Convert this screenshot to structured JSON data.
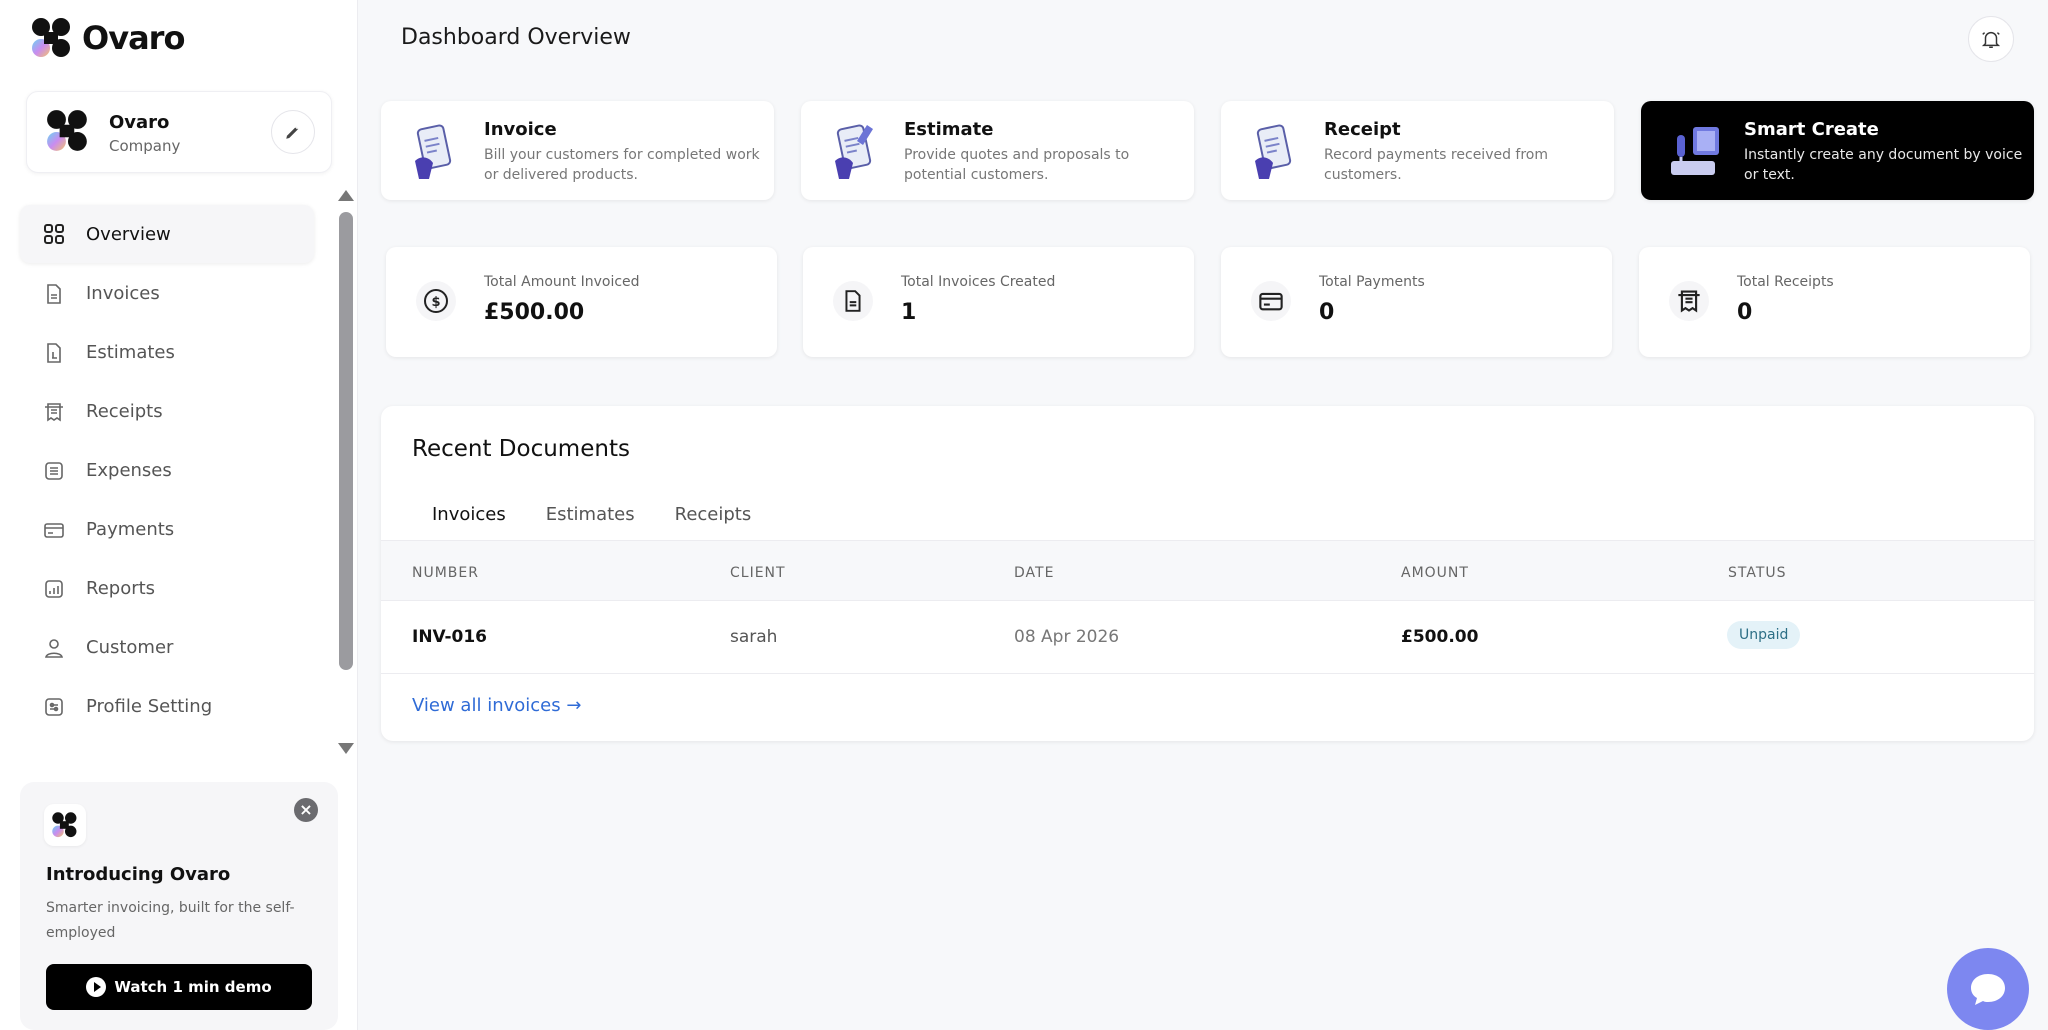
{
  "brand": {
    "name": "Ovaro"
  },
  "company": {
    "name": "Ovaro",
    "type": "Company"
  },
  "sidebar": {
    "items": [
      {
        "label": "Overview",
        "icon": "grid-icon",
        "active": true
      },
      {
        "label": "Invoices",
        "icon": "document-icon"
      },
      {
        "label": "Estimates",
        "icon": "estimate-icon"
      },
      {
        "label": "Receipts",
        "icon": "receipt-icon"
      },
      {
        "label": "Expenses",
        "icon": "list-icon"
      },
      {
        "label": "Payments",
        "icon": "card-icon"
      },
      {
        "label": "Reports",
        "icon": "chart-icon"
      },
      {
        "label": "Customer",
        "icon": "user-icon"
      },
      {
        "label": "Profile Setting",
        "icon": "settings-icon"
      }
    ]
  },
  "promo": {
    "title": "Introducing Ovaro",
    "text": "Smarter invoicing, built for the self-employed",
    "button": "Watch 1 min demo"
  },
  "header": {
    "title": "Dashboard Overview"
  },
  "actions": [
    {
      "title": "Invoice",
      "desc": "Bill your customers for completed work or delivered products."
    },
    {
      "title": "Estimate",
      "desc": "Provide quotes and proposals to potential customers."
    },
    {
      "title": "Receipt",
      "desc": "Record payments received from customers."
    },
    {
      "title": "Smart Create",
      "desc": "Instantly create any document by voice or text."
    }
  ],
  "stats": [
    {
      "label": "Total Amount Invoiced",
      "value": "£500.00",
      "icon": "dollar-icon"
    },
    {
      "label": "Total Invoices Created",
      "value": "1",
      "icon": "document-icon"
    },
    {
      "label": "Total Payments",
      "value": "0",
      "icon": "card-icon"
    },
    {
      "label": "Total Receipts",
      "value": "0",
      "icon": "receipt-icon"
    }
  ],
  "recent": {
    "title": "Recent Documents",
    "tabs": [
      "Invoices",
      "Estimates",
      "Receipts"
    ],
    "columns": [
      "NUMBER",
      "CLIENT",
      "DATE",
      "AMOUNT",
      "STATUS"
    ],
    "rows": [
      {
        "number": "INV-016",
        "client": "sarah",
        "date": "08 Apr 2026",
        "amount": "£500.00",
        "status": "Unpaid"
      }
    ],
    "view_all": "View all invoices →"
  },
  "colors": {
    "accent": "#2f6bd6",
    "chat": "#7d87f0",
    "status_bg": "#e4f2f8"
  }
}
